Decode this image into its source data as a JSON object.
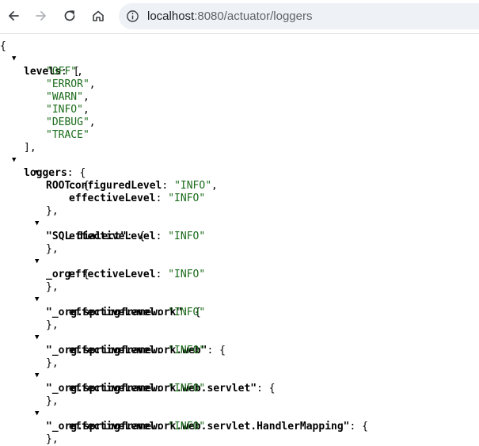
{
  "browser": {
    "url": "localhost:8080/actuator/loggers",
    "url_host": "localhost",
    "url_rest": ":8080/actuator/loggers"
  },
  "json": {
    "open_brace": "{",
    "levels_key": "levels",
    "levels": [
      "\"OFF\"",
      "\"ERROR\"",
      "\"WARN\"",
      "\"INFO\"",
      "\"DEBUG\"",
      "\"TRACE\""
    ],
    "loggers_key": "loggers",
    "configured_key": "configuredLevel",
    "effective_key": "effectiveLevel",
    "loggers": [
      {
        "name": "ROOT",
        "configured": "\"INFO\"",
        "effective": "\"INFO\""
      },
      {
        "name": "\"SQL dialect\"",
        "effective": "\"INFO\""
      },
      {
        "name": "_org",
        "effective": "\"INFO\""
      },
      {
        "name": "\"_org.springframework\"",
        "effective": "\"INFO\""
      },
      {
        "name": "\"_org.springframework.web\"",
        "effective": "\"INFO\""
      },
      {
        "name": "\"_org.springframework.web.servlet\"",
        "effective": "\"INFO\""
      },
      {
        "name": "\"_org.springframework.web.servlet.HandlerMapping\"",
        "effective": "\"INFO\""
      }
    ]
  },
  "colors": {
    "string": "#1a6b1a",
    "key": "#000000",
    "omnibox": "#eef1f6"
  },
  "icons": [
    "back-arrow-icon",
    "forward-arrow-icon",
    "reload-icon",
    "home-icon",
    "site-info-icon",
    "expand-triangle-icon"
  ]
}
